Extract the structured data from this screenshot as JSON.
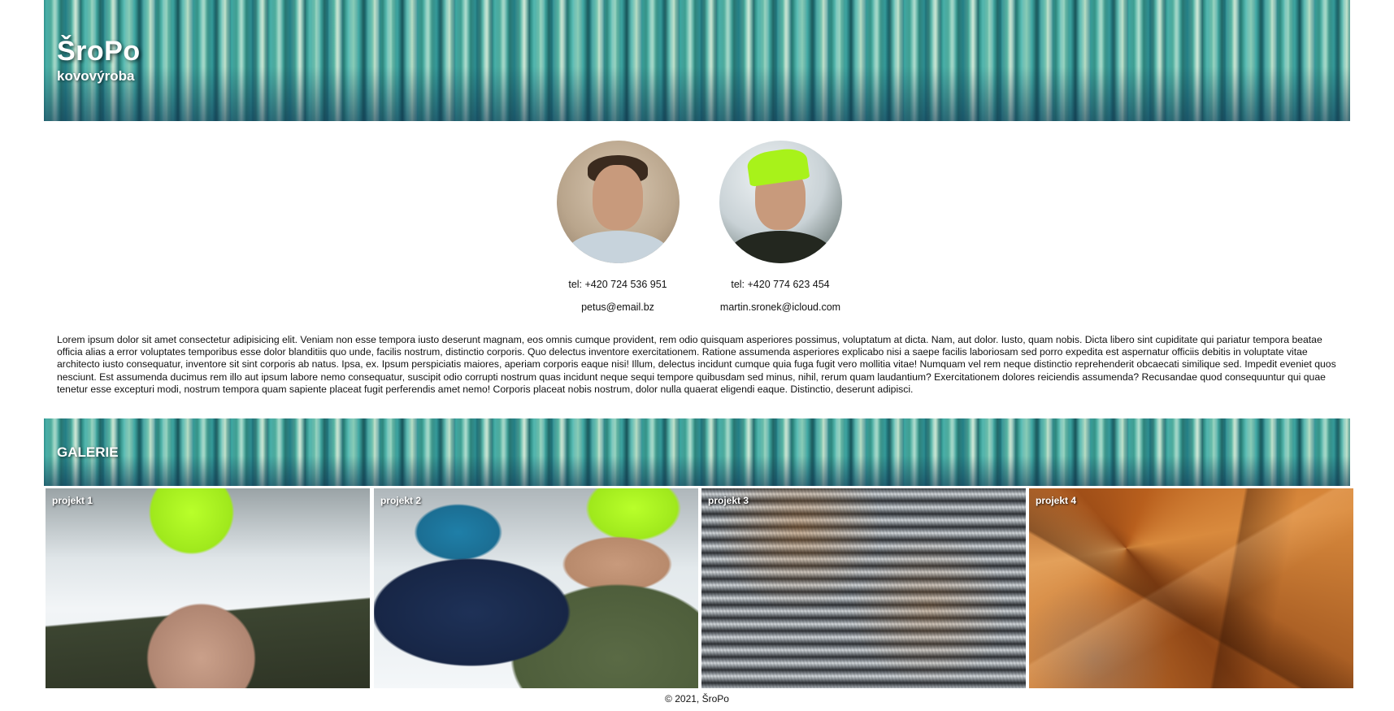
{
  "header": {
    "title": "ŠroPo",
    "subtitle": "kovovýroba"
  },
  "contacts": [
    {
      "tel": "tel: +420 724 536 951",
      "email": "petus@email.bz"
    },
    {
      "tel": "tel: +420 774 623 454",
      "email": "martin.sronek@icloud.com"
    }
  ],
  "intro": "Lorem ipsum dolor sit amet consectetur adipisicing elit. Veniam non esse tempora iusto deserunt magnam, eos omnis cumque provident, rem odio quisquam asperiores possimus, voluptatum at dicta. Nam, aut dolor. Iusto, quam nobis. Dicta libero sint cupiditate qui pariatur tempora beatae officia alias a error voluptates temporibus esse dolor blanditiis quo unde, facilis nostrum, distinctio corporis. Quo delectus inventore exercitationem. Ratione assumenda asperiores explicabo nisi a saepe facilis laboriosam sed porro expedita est aspernatur officiis debitis in voluptate vitae architecto iusto consequatur, inventore sit sint corporis ab natus. Ipsa, ex. Ipsum perspiciatis maiores, aperiam corporis eaque nisi! Illum, delectus incidunt cumque quia fuga fugit vero mollitia vitae! Numquam vel rem neque distinctio reprehenderit obcaecati similique sed. Impedit eveniet quos nesciunt. Est assumenda ducimus rem illo aut ipsum labore nemo consequatur, suscipit odio corrupti nostrum quas incidunt neque sequi tempore quibusdam sed minus, nihil, rerum quam laudantium? Exercitationem dolores reiciendis assumenda? Recusandae quod consequuntur qui quae tenetur esse excepturi modi, nostrum tempora quam sapiente placeat fugit perferendis amet nemo! Corporis placeat nobis nostrum, dolor nulla quaerat eligendi eaque. Distinctio, deserunt adipisci.",
  "gallery": {
    "title": "GALERIE",
    "items": [
      {
        "label": "projekt 1"
      },
      {
        "label": "projekt 2"
      },
      {
        "label": "projekt 3"
      },
      {
        "label": "projekt 4"
      }
    ]
  },
  "footer": "© 2021, ŠroPo",
  "colors": {
    "header_band": "#3a9a93",
    "text": "#111111",
    "background": "#ffffff"
  }
}
